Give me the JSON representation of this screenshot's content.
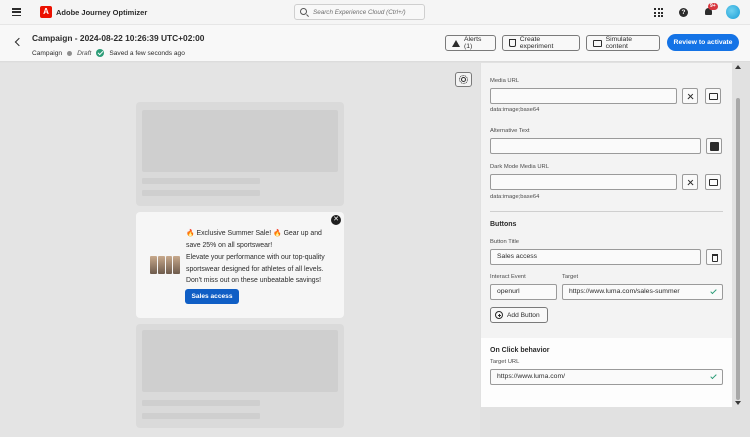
{
  "app": {
    "title": "Adobe Journey Optimizer",
    "logo_letter": "A"
  },
  "search": {
    "placeholder": "Search Experience Cloud (Ctrl+/)"
  },
  "notifications": {
    "badge": "9+"
  },
  "header": {
    "title": "Campaign - 2024-08-22 10:26:39 UTC+02:00",
    "type": "Campaign",
    "status": "Draft",
    "saved": "Saved a few seconds ago",
    "alerts_label": "Alerts (1)",
    "experiment_label": "Create experiment",
    "simulate_label": "Simulate content",
    "review_label": "Review to activate"
  },
  "preview": {
    "message_line1": "🔥 Exclusive Summer Sale! 🔥 Gear up and save 25% on all sportswear!",
    "message_line2": "Elevate your performance with our top-quality sportswear designed for athletes of all levels. Don't miss out on these unbeatable savings!",
    "cta_label": "Sales access",
    "close_glyph": "✕"
  },
  "panel": {
    "media_url_label": "Media URL",
    "media_url_value": "",
    "media_url_hint": "data:image;base64",
    "alt_text_label": "Alternative Text",
    "alt_text_value": "",
    "dark_media_label": "Dark Mode Media URL",
    "dark_media_value": "",
    "dark_media_hint": "data:image;base64",
    "buttons_section": "Buttons",
    "button_title_label": "Button Title",
    "button_title_value": "Sales access",
    "interact_event_label": "Interact Event",
    "interact_event_value": "openurl",
    "target_label": "Target",
    "target_value": "https://www.luma.com/sales-summer",
    "add_button_label": "Add Button",
    "on_click_section": "On Click behavior",
    "on_click_target_label": "Target URL",
    "on_click_target_value": "https://www.luma.com/"
  },
  "colors": {
    "accent": "#1473e6",
    "cta": "#0f5ec5",
    "success": "#2d9d78",
    "brand": "#eb1000"
  },
  "icons": [
    "menu-icon",
    "search-icon",
    "apps-grid-icon",
    "help-icon",
    "bell-icon",
    "alert-icon",
    "flask-icon",
    "simulate-icon",
    "sun-icon",
    "clear-icon",
    "image-picker-icon",
    "person-icon",
    "trash-icon",
    "plus-icon",
    "check-icon"
  ]
}
